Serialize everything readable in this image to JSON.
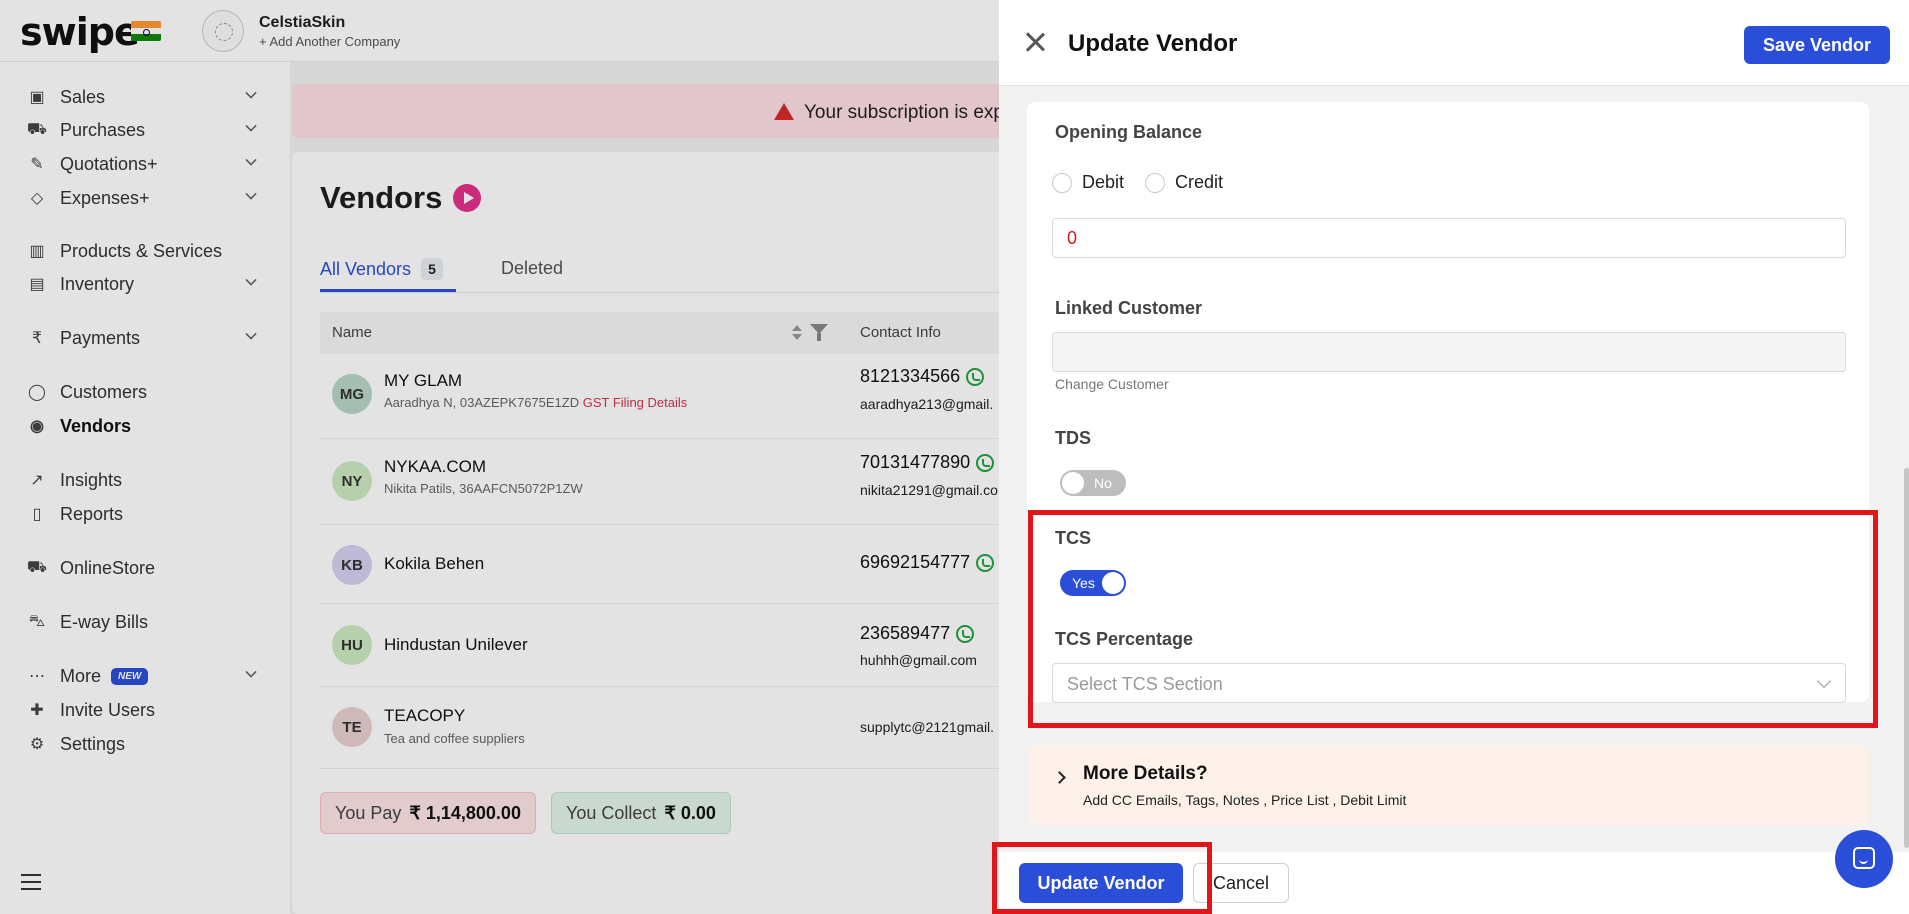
{
  "topbar": {
    "logo": "swipe",
    "company_name": "CelstiaSkin",
    "add_company": "+ Add Another Company"
  },
  "sidebar": {
    "items": [
      {
        "label": "Sales",
        "icon": "banknote-icon"
      },
      {
        "label": "Purchases",
        "icon": "cart-icon"
      },
      {
        "label": "Quotations+",
        "icon": "pencil-icon"
      },
      {
        "label": "Expenses+",
        "icon": "tag-icon"
      },
      {
        "label": "Products & Services",
        "icon": "barcode-icon"
      },
      {
        "label": "Inventory",
        "icon": "warehouse-icon"
      },
      {
        "label": "Payments",
        "icon": "rupee-icon"
      },
      {
        "label": "Customers",
        "icon": "user-icon"
      },
      {
        "label": "Vendors",
        "icon": "users-icon"
      },
      {
        "label": "Insights",
        "icon": "chart-icon"
      },
      {
        "label": "Reports",
        "icon": "document-icon"
      },
      {
        "label": "OnlineStore",
        "icon": "store-cart-icon"
      },
      {
        "label": "E-way Bills",
        "icon": "truck-icon"
      },
      {
        "label": "More",
        "icon": "dots-icon"
      },
      {
        "label": "Invite Users",
        "icon": "user-plus-icon"
      },
      {
        "label": "Settings",
        "icon": "gear-icon"
      }
    ],
    "new_badge": "NEW"
  },
  "banner": {
    "text": "Your subscription is expirin"
  },
  "vendors_page": {
    "title": "Vendors",
    "tabs": [
      {
        "label": "All Vendors",
        "count": "5"
      },
      {
        "label": "Deleted"
      }
    ],
    "columns": [
      "Name",
      "Contact Info"
    ],
    "rows": [
      {
        "initials": "MG",
        "avatar_color": "#b9d6c8",
        "name": "MY GLAM",
        "sub": "Aaradhya N, 03AZEPK7675E1ZD",
        "gst": "GST Filing Details",
        "phone": "8121334566",
        "email": "aaradhya213@gmail."
      },
      {
        "initials": "NY",
        "avatar_color": "#cdeac0",
        "name": "NYKAA.COM",
        "sub": "Nikita Patils, 36AAFCN5072P1ZW",
        "phone": "70131477890",
        "email": "nikita21291@gmail.co"
      },
      {
        "initials": "KB",
        "avatar_color": "#d6d0f0",
        "name": "Kokila Behen",
        "sub": "",
        "phone": "69692154777",
        "email": ""
      },
      {
        "initials": "HU",
        "avatar_color": "#cdeac0",
        "name": "Hindustan Unilever",
        "sub": "",
        "phone": "236589477",
        "email": "huhhh@gmail.com"
      },
      {
        "initials": "TE",
        "avatar_color": "#e8cfcf",
        "name": "TEACOPY",
        "sub": "Tea and coffee suppliers",
        "phone": "",
        "email": "supplytc@2121gmail."
      }
    ],
    "you_pay_label": "You Pay",
    "you_pay_amount": "₹ 1,14,800.00",
    "you_collect_label": "You Collect",
    "you_collect_amount": "₹ 0.00"
  },
  "drawer": {
    "title": "Update Vendor",
    "save_label": "Save Vendor",
    "opening_balance_label": "Opening Balance",
    "debit_label": "Debit",
    "credit_label": "Credit",
    "opening_balance_value": "0",
    "linked_customer_label": "Linked Customer",
    "change_customer": "Change Customer",
    "tds_label": "TDS",
    "tds_toggle": "No",
    "tcs_label": "TCS",
    "tcs_toggle": "Yes",
    "tcs_percentage_label": "TCS Percentage",
    "tcs_placeholder": "Select TCS Section",
    "more_title": "More Details?",
    "more_sub": "Add CC Emails, Tags, Notes , Price List , Debit Limit",
    "update_label": "Update Vendor",
    "cancel_label": "Cancel"
  },
  "colors": {
    "primary": "#2b4ed8",
    "highlight": "#e0161b",
    "danger_text": "#d21b1b"
  }
}
